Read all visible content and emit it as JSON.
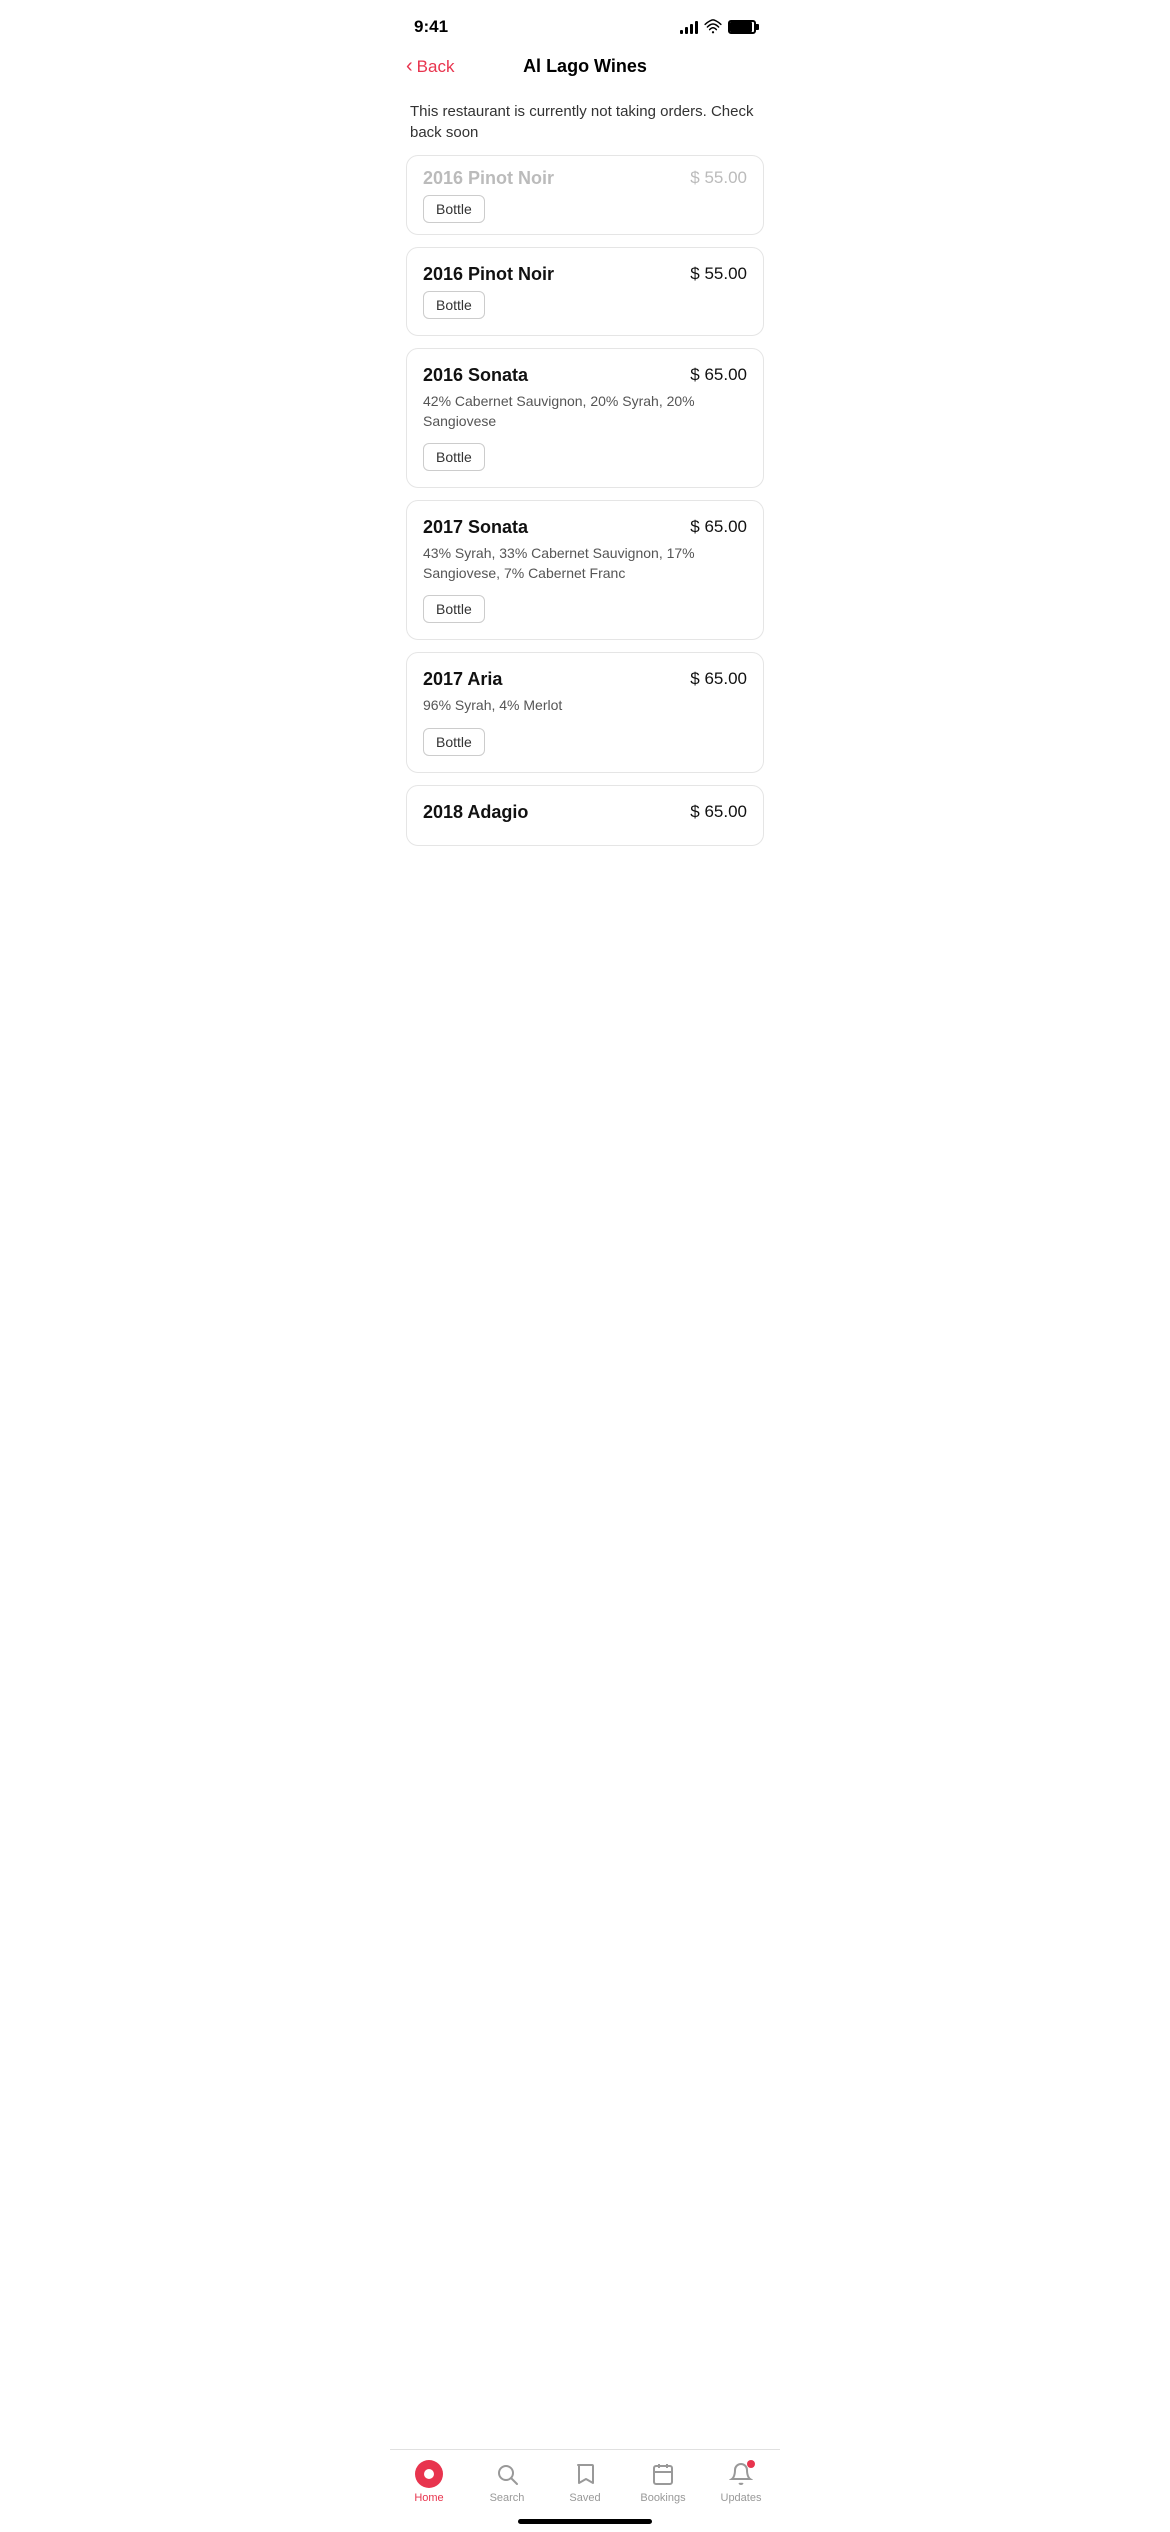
{
  "statusBar": {
    "time": "9:41"
  },
  "header": {
    "backLabel": "Back",
    "title": "Al Lago Wines"
  },
  "banner": {
    "message": "This restaurant is currently not taking orders. Check back soon"
  },
  "partialCard": {
    "name": "2016 Pinot Noir",
    "price": "$ 55.00",
    "bottleLabel": "Bottle"
  },
  "wines": [
    {
      "id": "wine-1",
      "name": "2016 Pinot Noir",
      "price": "$ 55.00",
      "description": "",
      "bottleLabel": "Bottle"
    },
    {
      "id": "wine-2",
      "name": "2016 Sonata",
      "price": "$ 65.00",
      "description": "42% Cabernet Sauvignon, 20% Syrah, 20% Sangiovese",
      "bottleLabel": "Bottle"
    },
    {
      "id": "wine-3",
      "name": "2017 Sonata",
      "price": "$ 65.00",
      "description": "43% Syrah, 33% Cabernet Sauvignon, 17% Sangiovese, 7% Cabernet Franc",
      "bottleLabel": "Bottle"
    },
    {
      "id": "wine-4",
      "name": "2017 Aria",
      "price": "$ 65.00",
      "description": "96% Syrah, 4% Merlot",
      "bottleLabel": "Bottle"
    },
    {
      "id": "wine-5",
      "name": "2018 Adagio",
      "price": "$ 65.00",
      "description": "",
      "bottleLabel": ""
    }
  ],
  "bottomNav": {
    "items": [
      {
        "id": "home",
        "label": "Home",
        "active": true
      },
      {
        "id": "search",
        "label": "Search",
        "active": false
      },
      {
        "id": "saved",
        "label": "Saved",
        "active": false
      },
      {
        "id": "bookings",
        "label": "Bookings",
        "active": false
      },
      {
        "id": "updates",
        "label": "Updates",
        "active": false
      }
    ]
  }
}
